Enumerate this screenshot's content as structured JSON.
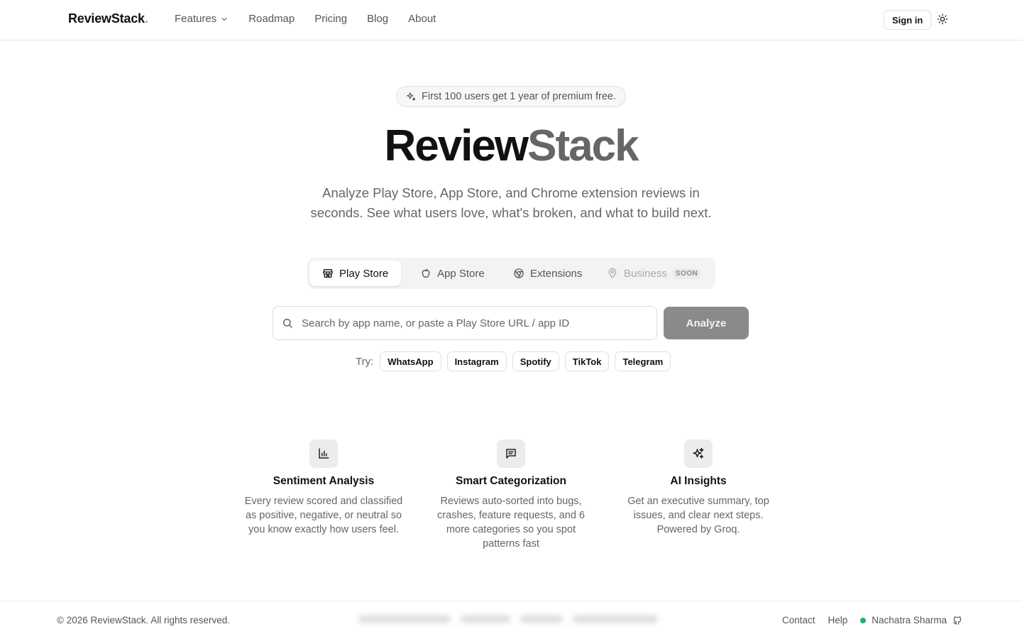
{
  "header": {
    "brand": "ReviewStack",
    "brand_suffix": ".",
    "nav": [
      "Features",
      "Roadmap",
      "Pricing",
      "Blog",
      "About"
    ],
    "signin_label": "Sign in",
    "theme_icon": "sun-icon"
  },
  "hero": {
    "promo": "First 100 users get 1 year of premium free.",
    "title_part1": "Review",
    "title_part2": "Stack",
    "subtitle": "Analyze Play Store, App Store, and Chrome extension reviews in seconds. See what users love, what's broken, and what to build next."
  },
  "tabs": [
    {
      "label": "Play Store",
      "icon": "store-icon",
      "active": true
    },
    {
      "label": "App Store",
      "icon": "apple-icon",
      "active": false
    },
    {
      "label": "Extensions",
      "icon": "chrome-icon",
      "active": false
    },
    {
      "label": "Business",
      "icon": "map-pin-icon",
      "active": false,
      "badge": "SOON"
    }
  ],
  "search": {
    "placeholder": "Search by app name, or paste a Play Store URL / app ID",
    "value": "",
    "button": "Analyze"
  },
  "try": {
    "label": "Try:",
    "chips": [
      "WhatsApp",
      "Instagram",
      "Spotify",
      "TikTok",
      "Telegram"
    ]
  },
  "features": [
    {
      "icon": "bar-chart-icon",
      "title": "Sentiment Analysis",
      "desc": "Every review scored and classified as positive, negative, or neutral so you know exactly how users feel."
    },
    {
      "icon": "message-square-icon",
      "title": "Smart Categorization",
      "desc": "Reviews auto-sorted into bugs, crashes, feature requests, and 6 more categories so you spot patterns fast"
    },
    {
      "icon": "sparkles-icon",
      "title": "AI Insights",
      "desc": "Get an executive summary, top issues, and clear next steps. Powered by Groq."
    }
  ],
  "footer": {
    "copyright": "© 2026 ReviewStack. All rights reserved.",
    "links": [
      "Contact",
      "Help"
    ],
    "author": "Nachatra Sharma",
    "status_color": "#16b364"
  }
}
